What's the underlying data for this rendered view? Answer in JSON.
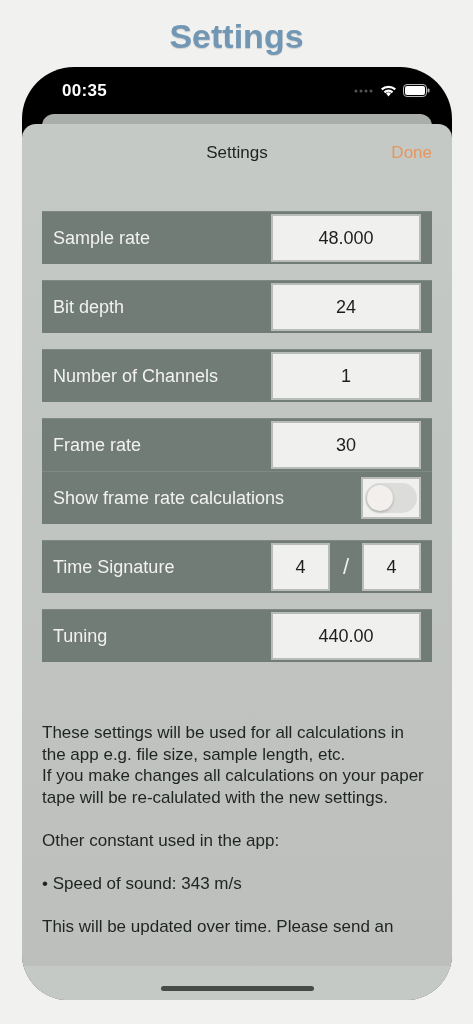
{
  "page_title": "Settings",
  "status_bar": {
    "time": "00:35"
  },
  "nav": {
    "title": "Settings",
    "done": "Done"
  },
  "groups": [
    {
      "rows": [
        {
          "kind": "value",
          "label": "Sample rate",
          "value": "48.000"
        }
      ]
    },
    {
      "rows": [
        {
          "kind": "value",
          "label": "Bit depth",
          "value": "24"
        }
      ]
    },
    {
      "rows": [
        {
          "kind": "value",
          "label": "Number of Channels",
          "value": "1"
        }
      ]
    },
    {
      "rows": [
        {
          "kind": "value",
          "label": "Frame rate",
          "value": "30"
        },
        {
          "kind": "toggle",
          "label": "Show frame rate calculations",
          "on": false
        }
      ]
    },
    {
      "rows": [
        {
          "kind": "fraction",
          "label": "Time Signature",
          "values": [
            "4",
            "4"
          ],
          "separator": "/"
        }
      ]
    },
    {
      "rows": [
        {
          "kind": "value",
          "label": "Tuning",
          "value": "440.00"
        }
      ]
    }
  ],
  "notes": [
    {
      "lines": [
        "These settings will be used for all calculations in the app e.g. file size, sample length, etc.",
        "If you make changes all calculations on your paper tape will be re-calulated with the new settings."
      ]
    },
    {
      "lines": [
        "Other constant used in the app:"
      ]
    },
    {
      "lines": [
        "• Speed of sound: 343 m/s"
      ]
    },
    {
      "lines": [
        "This will be updated over time. Please send an"
      ]
    }
  ]
}
